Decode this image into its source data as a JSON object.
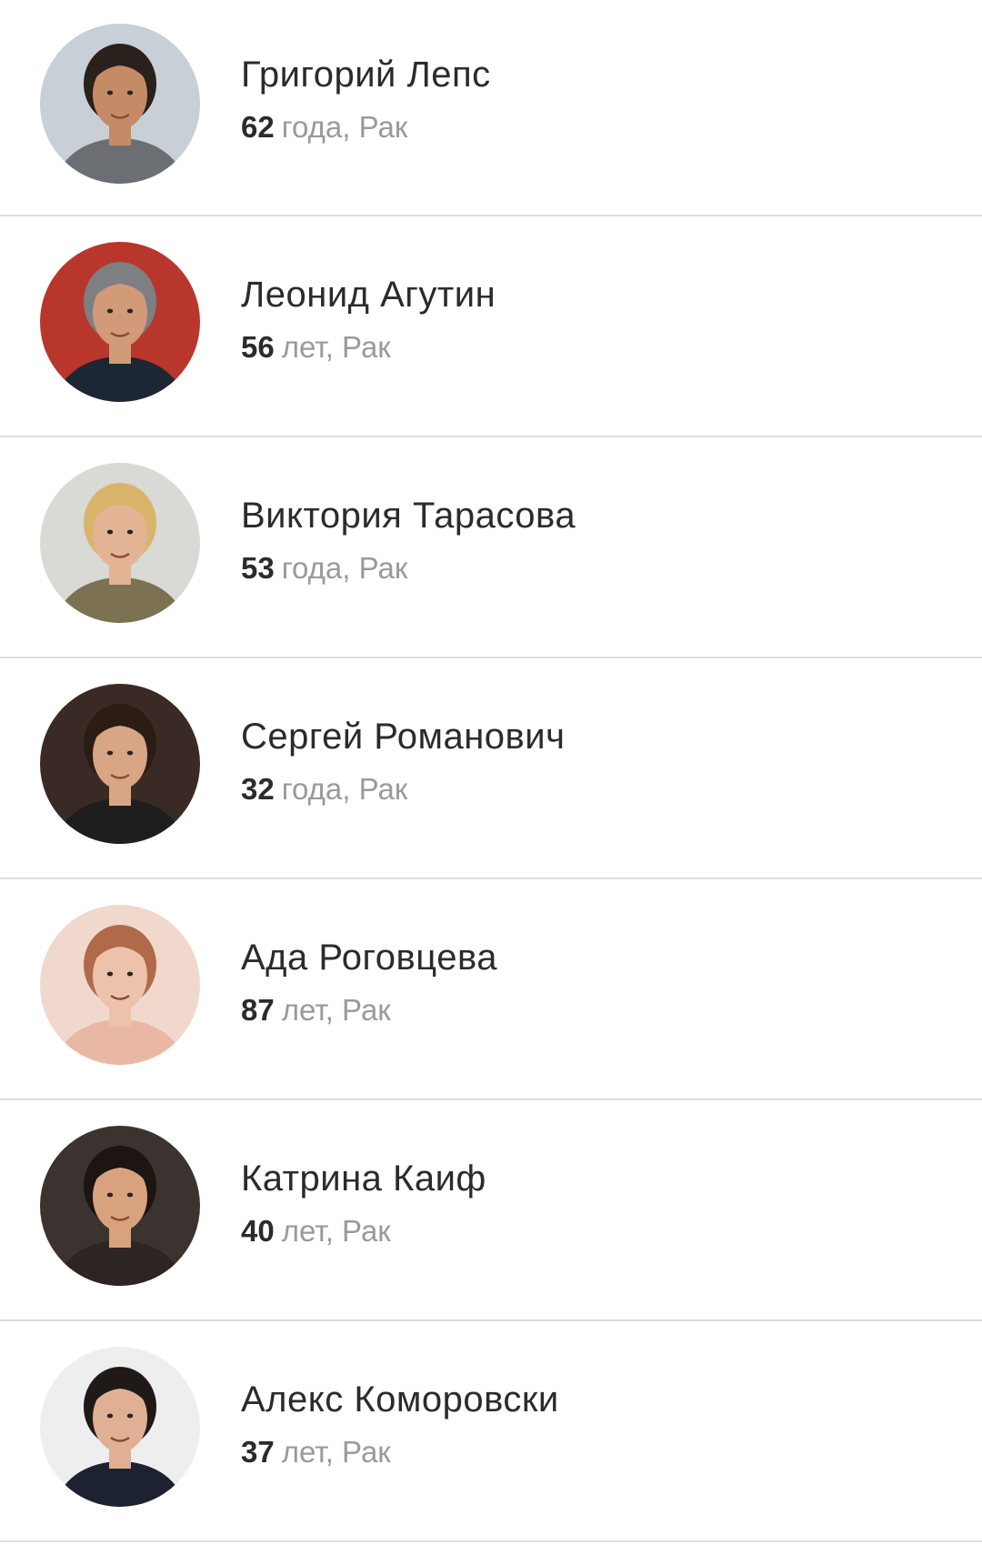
{
  "people": [
    {
      "name": "Григорий Лепс",
      "age": "62",
      "rest": "года, Рак",
      "avatar_icon": "avatar-photo-icon",
      "colors": {
        "bg": "#c9cfd6",
        "skin": "#c48b66",
        "hair": "#2a211c",
        "cloth": "#6b6f73"
      }
    },
    {
      "name": "Леонид Агутин",
      "age": "56",
      "rest": "лет, Рак",
      "avatar_icon": "avatar-photo-icon",
      "colors": {
        "bg": "#b8362c",
        "skin": "#d19a78",
        "hair": "#7d7f83",
        "cloth": "#1d2633"
      }
    },
    {
      "name": "Виктория Тарасова",
      "age": "53",
      "rest": "года, Рак",
      "avatar_icon": "avatar-photo-icon",
      "colors": {
        "bg": "#d9d9d6",
        "skin": "#e2b494",
        "hair": "#d8b56a",
        "cloth": "#7c7152"
      }
    },
    {
      "name": "Сергей Романович",
      "age": "32",
      "rest": "года, Рак",
      "avatar_icon": "avatar-photo-icon",
      "colors": {
        "bg": "#3a2a26",
        "skin": "#d8a684",
        "hair": "#2b1c14",
        "cloth": "#1e1e1e"
      }
    },
    {
      "name": "Ада Роговцева",
      "age": "87",
      "rest": "лет, Рак",
      "avatar_icon": "avatar-photo-icon",
      "colors": {
        "bg": "#f0d8cc",
        "skin": "#ecc2ad",
        "hair": "#b06a4a",
        "cloth": "#e9b8a4"
      }
    },
    {
      "name": "Катрина Каиф",
      "age": "40",
      "rest": "лет, Рак",
      "avatar_icon": "avatar-photo-icon",
      "colors": {
        "bg": "#3b3330",
        "skin": "#d9a27e",
        "hair": "#1c1512",
        "cloth": "#2d2522"
      }
    },
    {
      "name": "Алекс Коморовски",
      "age": "37",
      "rest": "лет, Рак",
      "avatar_icon": "avatar-photo-icon",
      "colors": {
        "bg": "#eeeeee",
        "skin": "#e0b095",
        "hair": "#1f1a17",
        "cloth": "#1c2230"
      }
    }
  ]
}
